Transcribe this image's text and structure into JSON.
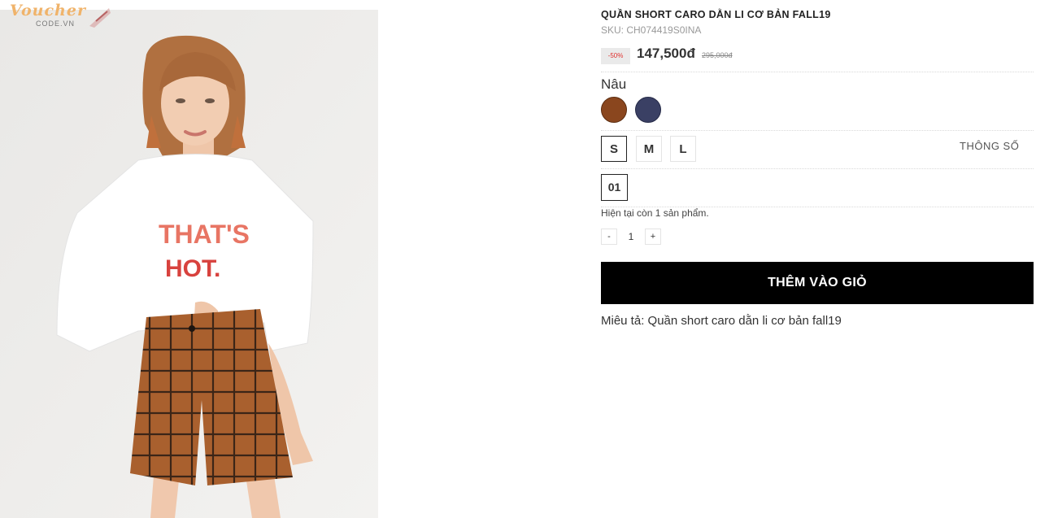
{
  "watermark": {
    "top": "Voucher",
    "bottom": "CODE.VN"
  },
  "photo": {
    "shirt_text_line1": "THAT'S",
    "shirt_text_line2": "HOT."
  },
  "product": {
    "title": "QUẦN SHORT CARO DẰN LI CƠ BẢN FALL19",
    "sku": "SKU: CH074419S0INA",
    "discount_badge": "-50%",
    "price": "147,500đ",
    "old_price": "295,000đ",
    "selected_color_name": "Nâu",
    "colors": [
      {
        "name": "brown",
        "hex": "#8a461e"
      },
      {
        "name": "navy",
        "hex": "#3a4064"
      }
    ],
    "sizes": [
      "S",
      "M",
      "L"
    ],
    "selected_size": "S",
    "size_chart_link": "THÔNG SỐ",
    "variant": "01",
    "stock_text": "Hiện tại còn 1 sản phẩm.",
    "quantity": {
      "minus": "-",
      "value": "1",
      "plus": "+"
    },
    "add_to_cart": "THÊM VÀO GIỎ",
    "description": "Miêu tả: Quần short caro dằn li cơ bản fall19"
  },
  "colors": {
    "accent_red": "#e0312f",
    "button_bg": "#000000"
  }
}
